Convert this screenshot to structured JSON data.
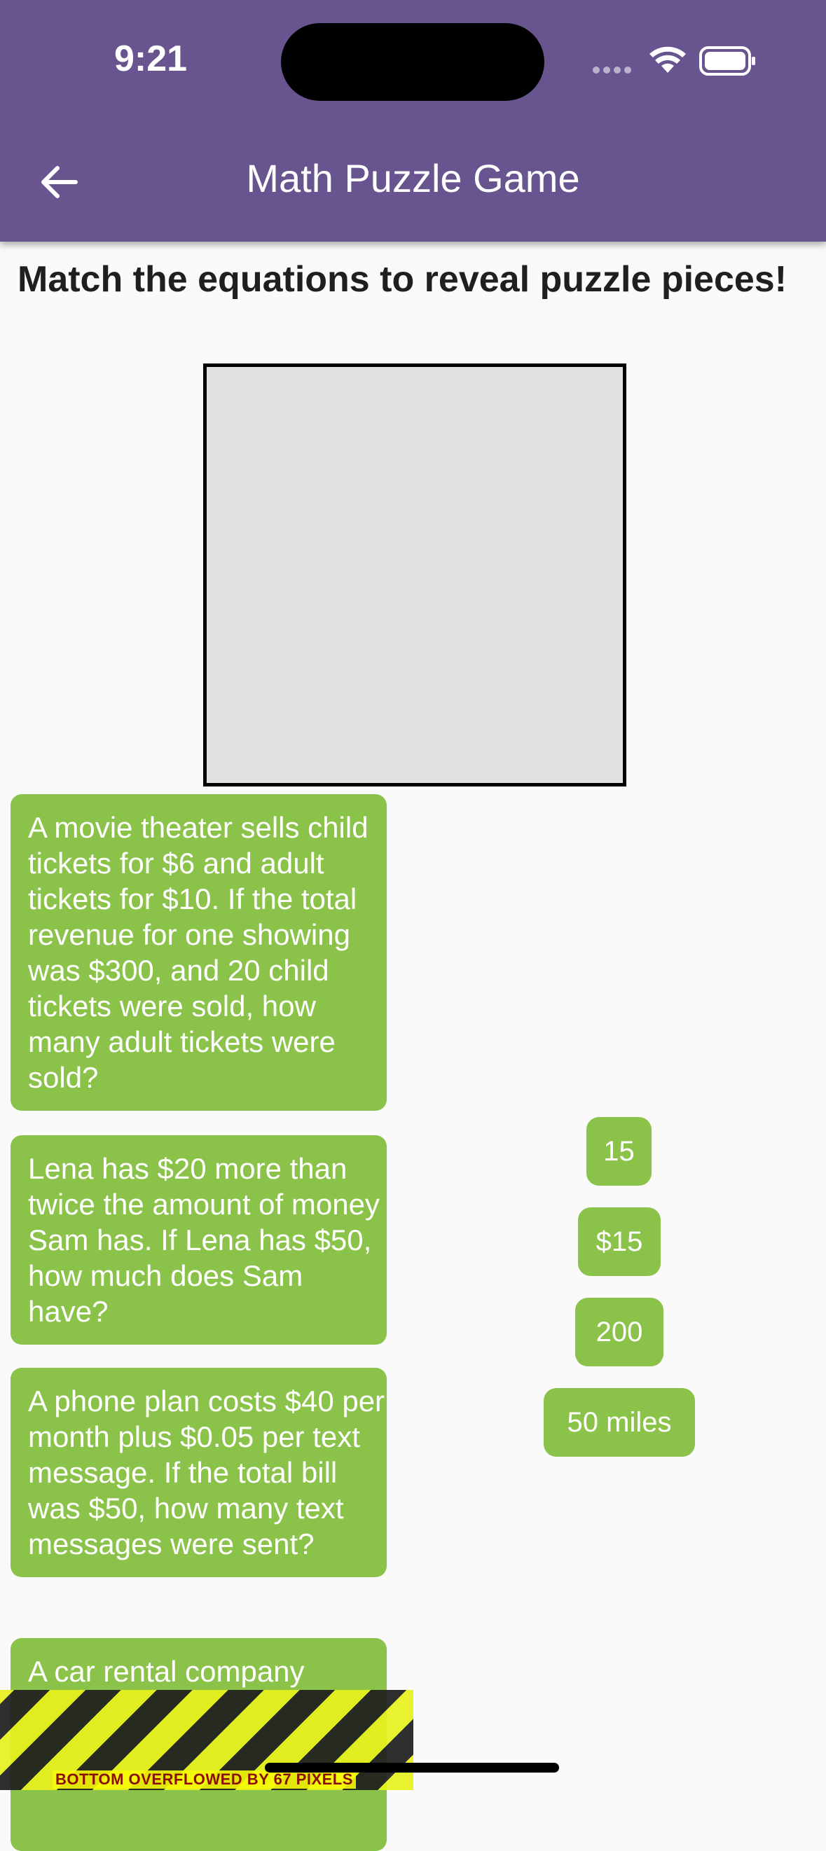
{
  "status_bar": {
    "time": "9:21"
  },
  "app_bar": {
    "title": "Math Puzzle Game"
  },
  "heading": "Match the equations to reveal puzzle pieces!",
  "questions": [
    "A movie theater sells child tickets for $6 and adult tickets for $10. If the total revenue for one showing was $300, and 20 child tickets were sold, how many adult tickets were sold?",
    "Lena has $20 more than twice the amount of money Sam has. If Lena has $50, how much does Sam have?",
    "A phone plan costs $40 per month plus $0.05 per text message. If the total bill was $50, how many text messages were sent?",
    "A car rental company"
  ],
  "answers": [
    "15",
    "$15",
    "200",
    "50 miles"
  ],
  "overflow_warning": "BOTTOM OVERFLOWED BY 67 PIXELS"
}
